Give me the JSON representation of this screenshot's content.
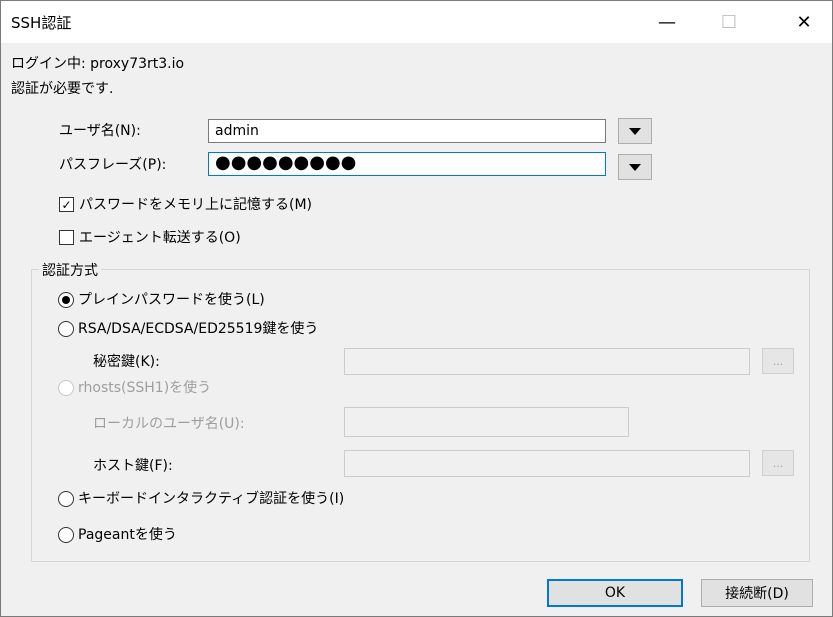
{
  "window": {
    "title": "SSH認証",
    "minimize": "—",
    "maximize": "☐",
    "close": "✕"
  },
  "info": {
    "login_line": "ログイン中: proxy73rt3.io",
    "auth_required": "認証が必要です."
  },
  "fields": {
    "user_label": "ユーザ名(N):",
    "user_value": "admin",
    "pass_label": "パスフレーズ(P):",
    "pass_value": "●●●●●●●●●"
  },
  "checkboxes": {
    "remember_password": {
      "label": "パスワードをメモリ上に記憶する(M)",
      "checked": true
    },
    "agent_forwarding": {
      "label": "エージェント転送する(O)",
      "checked": false
    }
  },
  "auth_method": {
    "group_label": "認証方式",
    "plain_password": "プレインパスワードを使う(L)",
    "rsa": "RSA/DSA/ECDSA/ED25519鍵を使う",
    "private_key_label": "秘密鍵(K):",
    "rhosts": "rhosts(SSH1)を使う",
    "local_user_label": "ローカルのユーザ名(U):",
    "host_key_label": "ホスト鍵(F):",
    "keyboard_interactive": "キーボードインタラクティブ認証を使う(I)",
    "pageant": "Pageantを使う",
    "browse": "..."
  },
  "buttons": {
    "ok": "OK",
    "disconnect": "接続断(D)"
  }
}
